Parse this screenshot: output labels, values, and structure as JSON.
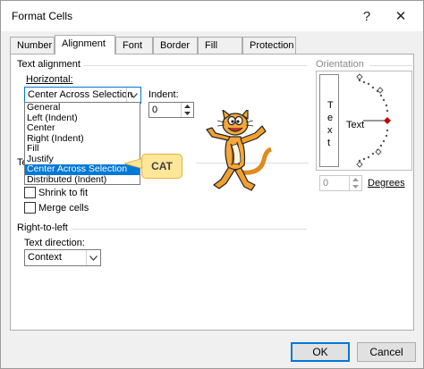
{
  "window": {
    "title": "Format Cells",
    "help_glyph": "?",
    "close_glyph": "✕"
  },
  "tabs": [
    {
      "label": "Number"
    },
    {
      "label": "Alignment",
      "active": true
    },
    {
      "label": "Font"
    },
    {
      "label": "Border"
    },
    {
      "label": "Fill"
    },
    {
      "label": "Protection"
    }
  ],
  "text_alignment": {
    "group_label": "Text alignment",
    "horizontal_label": "Horizontal:",
    "horizontal_value": "Center Across Selection",
    "horizontal_options": [
      "General",
      "Left (Indent)",
      "Center",
      "Right (Indent)",
      "Fill",
      "Justify",
      "Center Across Selection",
      "Distributed (Indent)"
    ],
    "selected_option": "Center Across Selection",
    "indent_label": "Indent:",
    "indent_value": "0",
    "partial_label": "Te"
  },
  "text_control": {
    "shrink_label": "Shrink to fit",
    "merge_label": "Merge cells"
  },
  "rtl": {
    "group_label": "Right-to-left",
    "direction_label": "Text direction:",
    "direction_value": "Context"
  },
  "orientation": {
    "group_label": "Orientation",
    "vertical_text": [
      "T",
      "e",
      "x",
      "t"
    ],
    "dial_label": "Text",
    "degrees_value": "0",
    "degrees_label": "Degrees"
  },
  "callout": {
    "text": "CAT",
    "fill_color": "#ffe699"
  },
  "buttons": {
    "ok": "OK",
    "cancel": "Cancel"
  },
  "colors": {
    "selection": "#0078d7",
    "accent_red": "#c00000"
  }
}
